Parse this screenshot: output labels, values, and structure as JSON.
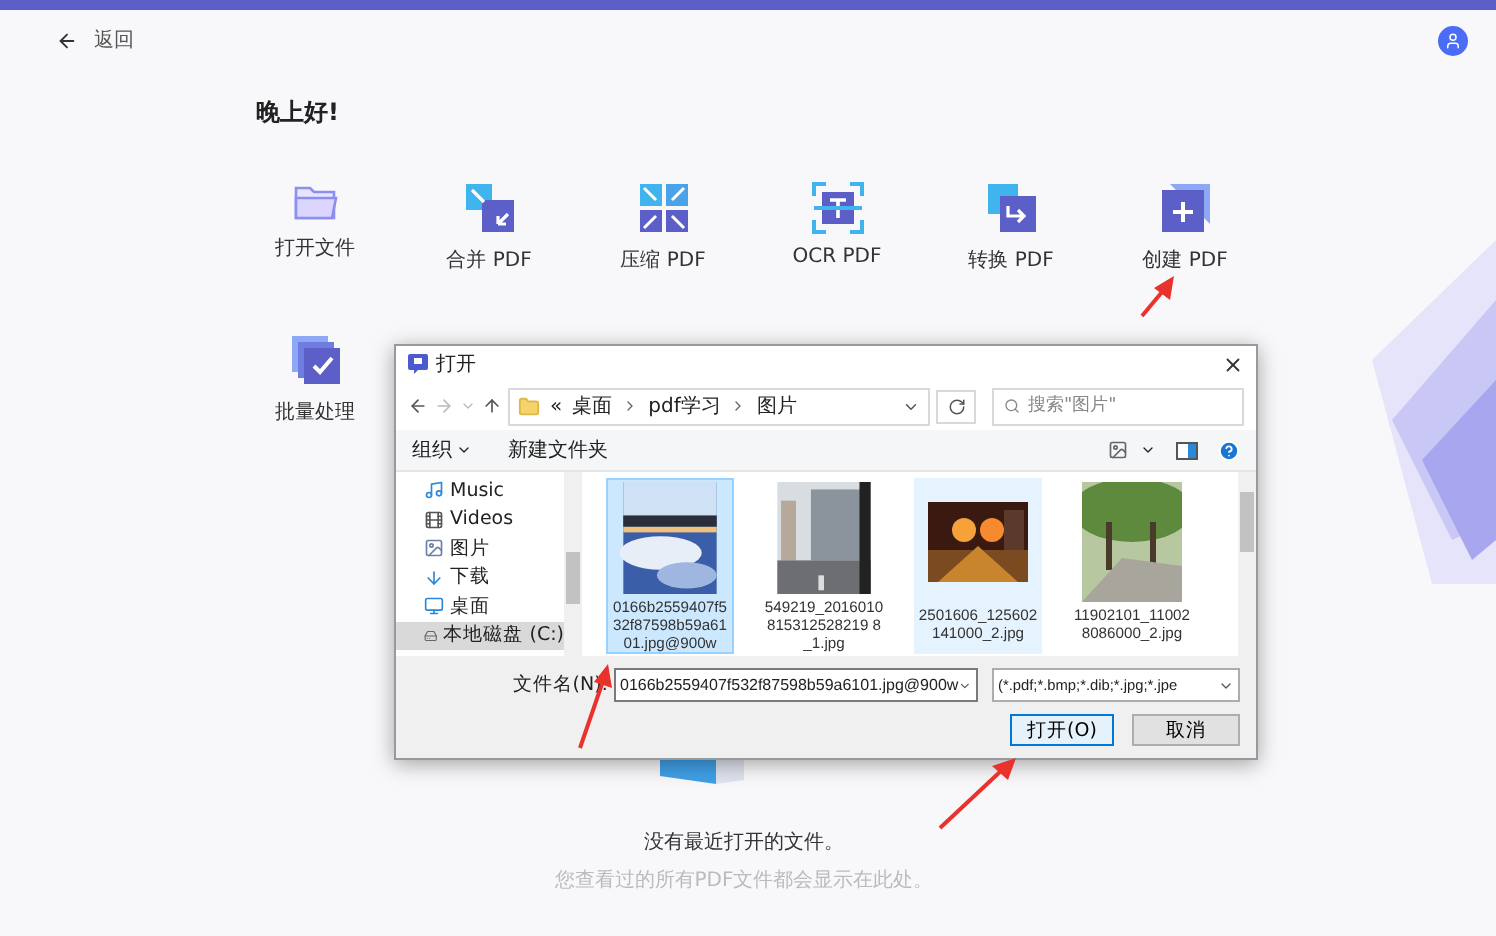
{
  "header": {
    "back_label": "返回"
  },
  "greeting": "晚上好!",
  "tools": [
    {
      "label": "打开文件",
      "kind": "folder"
    },
    {
      "label": "合并 PDF",
      "kind": "merge"
    },
    {
      "label": "压缩 PDF",
      "kind": "compress"
    },
    {
      "label": "OCR PDF",
      "kind": "ocr"
    },
    {
      "label": "转换 PDF",
      "kind": "convert"
    },
    {
      "label": "创建 PDF",
      "kind": "create"
    },
    {
      "label": "批量处理",
      "kind": "batch"
    }
  ],
  "empty_state": {
    "title": "没有最近打开的文件。",
    "hint": "您查看过的所有PDF文件都会显示在此处。"
  },
  "dialog": {
    "title": "打开",
    "breadcrumb_overflow": "«",
    "breadcrumb": [
      "桌面",
      "pdf学习",
      "图片"
    ],
    "search": {
      "placeholder": "搜索\"图片\""
    },
    "toolbar": {
      "organize": "组织",
      "new_folder": "新建文件夹"
    },
    "sidebar": [
      {
        "label": "Music",
        "kind": "music",
        "selected": false
      },
      {
        "label": "Videos",
        "kind": "video",
        "selected": false
      },
      {
        "label": "图片",
        "kind": "picture",
        "selected": false
      },
      {
        "label": "下载",
        "kind": "download",
        "selected": false
      },
      {
        "label": "桌面",
        "kind": "desktop",
        "selected": false
      },
      {
        "label": "本地磁盘 (C:)",
        "kind": "drive",
        "selected": true
      }
    ],
    "files": [
      {
        "name": "0166b2559407f532f87598b59a6101.jpg@900w",
        "selected": true,
        "hovered": false
      },
      {
        "name": "549219_2016010815312528219 8_1.jpg",
        "selected": false,
        "hovered": false
      },
      {
        "name": "2501606_125602141000_2.jpg",
        "selected": false,
        "hovered": true
      },
      {
        "name": "11902101_110028086000_2.jpg",
        "selected": false,
        "hovered": false
      }
    ],
    "filename_label": "文件名(N):",
    "filename_value": "0166b2559407f532f87598b59a6101.jpg@900w",
    "filetype": "(*.pdf;*.bmp;*.dib;*.jpg;*.jpe",
    "buttons": [
      {
        "label": "打开(O)",
        "kind": "primary"
      },
      {
        "label": "取消",
        "kind": "secondary"
      }
    ]
  }
}
